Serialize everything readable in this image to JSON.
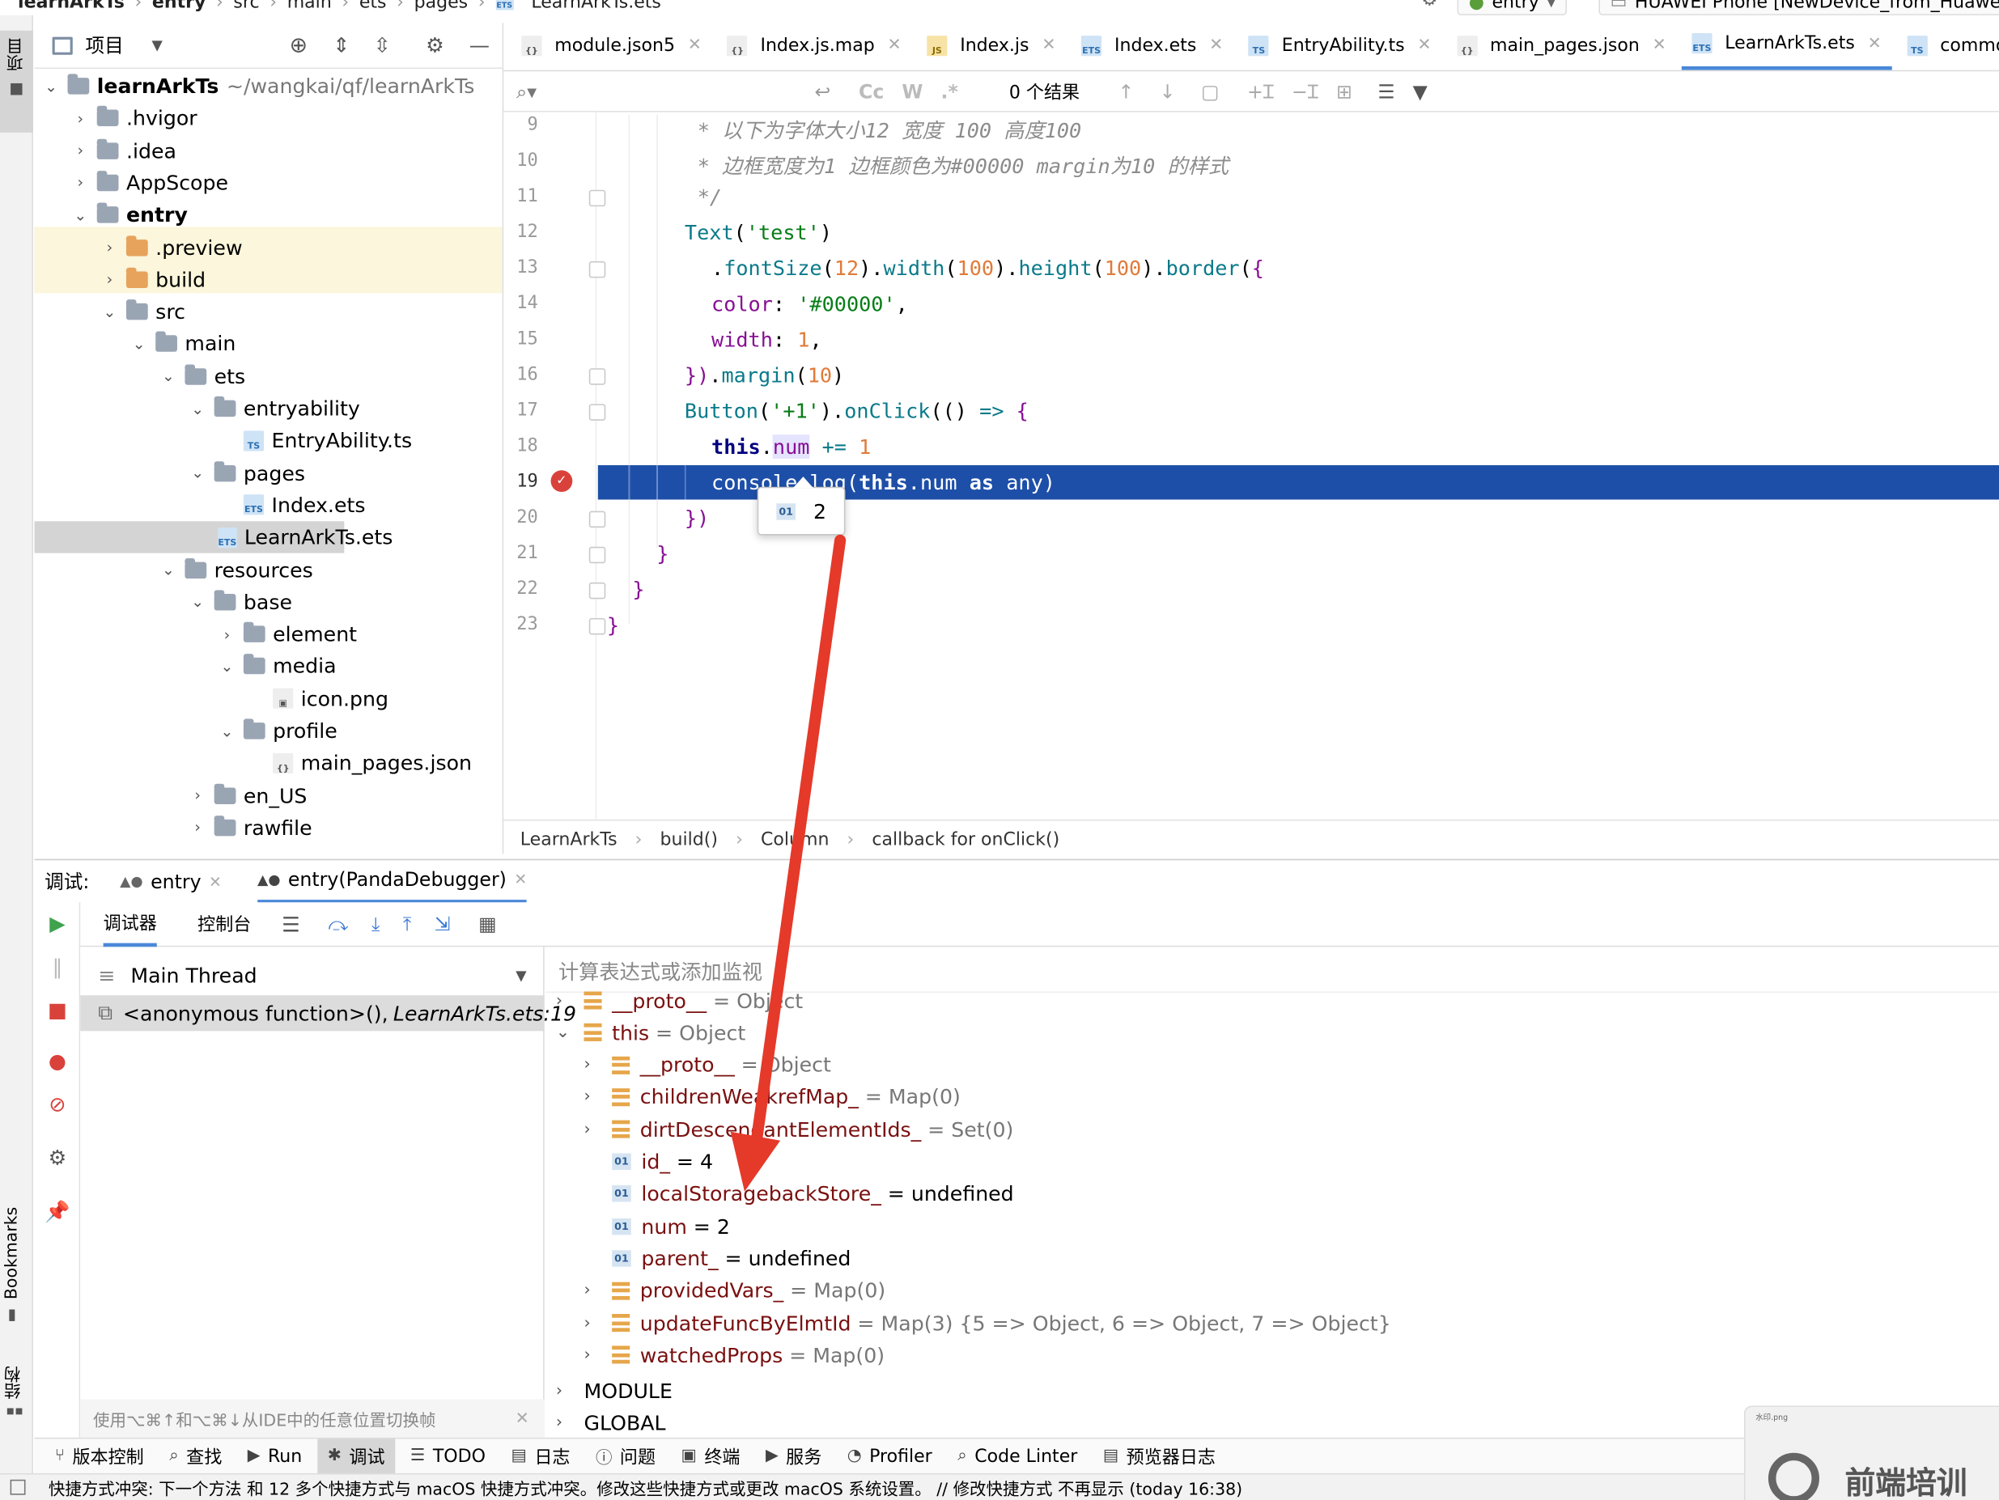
{
  "top_strip": {
    "breadcrumbs": [
      "learnArkTs",
      "entry",
      "src",
      "main",
      "ets",
      "pages",
      "LearnArkTs.ets"
    ],
    "run_config": "entry",
    "device": "HUAWEI Phone [NewDevice_from_Huawei_"
  },
  "left_strip": {
    "project_label": "项目",
    "bookmarks_label": "Bookmarks",
    "structure_label": "结构"
  },
  "project_panel": {
    "title": "项目",
    "root_name": "learnArkTs",
    "root_path": "~/wangkai/qf/learnArkTs",
    "items": [
      {
        "label": ".hvigor",
        "depth": 1,
        "type": "folder",
        "expanded": false
      },
      {
        "label": ".idea",
        "depth": 1,
        "type": "folder",
        "expanded": false
      },
      {
        "label": "AppScope",
        "depth": 1,
        "type": "folder",
        "expanded": false
      },
      {
        "label": "entry",
        "depth": 1,
        "type": "module",
        "expanded": true
      },
      {
        "label": ".preview",
        "depth": 2,
        "type": "folder-orange",
        "expanded": false
      },
      {
        "label": "build",
        "depth": 2,
        "type": "folder-orange",
        "expanded": false
      },
      {
        "label": "src",
        "depth": 2,
        "type": "folder",
        "expanded": true
      },
      {
        "label": "main",
        "depth": 3,
        "type": "folder",
        "expanded": true
      },
      {
        "label": "ets",
        "depth": 4,
        "type": "folder",
        "expanded": true
      },
      {
        "label": "entryability",
        "depth": 5,
        "type": "folder",
        "expanded": true
      },
      {
        "label": "EntryAbility.ts",
        "depth": 6,
        "type": "ts"
      },
      {
        "label": "pages",
        "depth": 5,
        "type": "folder",
        "expanded": true
      },
      {
        "label": "Index.ets",
        "depth": 6,
        "type": "ets"
      },
      {
        "label": "LearnArkTs.ets",
        "depth": 6,
        "type": "ets",
        "selected": true
      },
      {
        "label": "resources",
        "depth": 4,
        "type": "folder",
        "expanded": true
      },
      {
        "label": "base",
        "depth": 5,
        "type": "folder",
        "expanded": true
      },
      {
        "label": "element",
        "depth": 6,
        "type": "folder",
        "expanded": false
      },
      {
        "label": "media",
        "depth": 6,
        "type": "folder",
        "expanded": true
      },
      {
        "label": "icon.png",
        "depth": 7,
        "type": "png"
      },
      {
        "label": "profile",
        "depth": 6,
        "type": "folder",
        "expanded": true
      },
      {
        "label": "main_pages.json",
        "depth": 7,
        "type": "json"
      },
      {
        "label": "en_US",
        "depth": 5,
        "type": "folder",
        "expanded": false
      },
      {
        "label": "rawfile",
        "depth": 5,
        "type": "folder",
        "expanded": false
      }
    ]
  },
  "editor_tabs": [
    {
      "label": "module.json5",
      "icon": "json"
    },
    {
      "label": "Index.js.map",
      "icon": "json"
    },
    {
      "label": "Index.js",
      "icon": "js"
    },
    {
      "label": "Index.ets",
      "icon": "ets"
    },
    {
      "label": "EntryAbility.ts",
      "icon": "ts"
    },
    {
      "label": "main_pages.json",
      "icon": "json"
    },
    {
      "label": "LearnArkTs.ets",
      "icon": "ets",
      "active": true
    },
    {
      "label": "common.d.ts",
      "icon": "ts"
    },
    {
      "label": "TS",
      "icon": "ts"
    }
  ],
  "search_bar": {
    "results": "0 个结果",
    "cc": "Cc",
    "w": "W",
    "regex": ".*"
  },
  "editor": {
    "line_numbers": [
      "9",
      "10",
      "11",
      "12",
      "13",
      "14",
      "15",
      "16",
      "17",
      "18",
      "19",
      "20",
      "21",
      "22",
      "23"
    ],
    "current_line": "19",
    "tooltip_value": "2",
    "breadcrumb": [
      "LearnArkTs",
      "build()",
      "Column",
      "callback for onClick()"
    ]
  },
  "debug_panel": {
    "label": "调试:",
    "sessions": [
      "entry",
      "entry(PandaDebugger)"
    ],
    "tabs": [
      "调试器",
      "控制台"
    ],
    "thread": "Main Thread",
    "frame_name": "<anonymous function>(),",
    "frame_loc": "LearnArkTs.ets:19",
    "hint": "使用⌥⌘↑和⌥⌘↓从IDE中的任意位置切换帧",
    "eval_placeholder": "计算表达式或添加监视"
  },
  "variables": [
    {
      "name": "__proto__",
      "value": "= Object",
      "depth": 1,
      "icon": "map",
      "expandable": true,
      "gray": true
    },
    {
      "name": "this",
      "value": "= Object",
      "depth": 1,
      "icon": "map",
      "expandable": true,
      "expanded": true,
      "gray": true
    },
    {
      "name": "__proto__",
      "value": "= Object",
      "depth": 2,
      "icon": "map",
      "expandable": true,
      "gray": true
    },
    {
      "name": "childrenWeakrefMap_",
      "value": "= Map(0)",
      "depth": 2,
      "icon": "map",
      "expandable": true,
      "gray": true
    },
    {
      "name": "dirtDescendantElementIds_",
      "value": "= Set(0)",
      "depth": 2,
      "icon": "map",
      "expandable": true,
      "gray": true
    },
    {
      "name": "id_",
      "value": "= 4",
      "depth": 2,
      "icon": "o1"
    },
    {
      "name": "localStoragebackStore_",
      "value": "= undefined",
      "depth": 2,
      "icon": "o1"
    },
    {
      "name": "num",
      "value": "= 2",
      "depth": 2,
      "icon": "o1"
    },
    {
      "name": "parent_",
      "value": "= undefined",
      "depth": 2,
      "icon": "o1"
    },
    {
      "name": "providedVars_",
      "value": "= Map(0)",
      "depth": 2,
      "icon": "map",
      "expandable": true,
      "gray": true
    },
    {
      "name": "updateFuncByElmtId",
      "value": "= Map(3) {5 => Object, 6 => Object, 7 => Object}",
      "depth": 2,
      "icon": "map",
      "expandable": true,
      "gray": true
    },
    {
      "name": "watchedProps",
      "value": "= Map(0)",
      "depth": 2,
      "icon": "map",
      "expandable": true,
      "gray": true
    }
  ],
  "sections": [
    "MODULE",
    "GLOBAL"
  ],
  "bottom_tools": [
    {
      "label": "版本控制",
      "icon": "vcs-icon"
    },
    {
      "label": "查找",
      "icon": "search-icon"
    },
    {
      "label": "Run",
      "icon": "run-icon"
    },
    {
      "label": "调试",
      "icon": "debug-icon",
      "active": true
    },
    {
      "label": "TODO",
      "icon": "list-icon"
    },
    {
      "label": "日志",
      "icon": "log-icon"
    },
    {
      "label": "问题",
      "icon": "problem-icon"
    },
    {
      "label": "终端",
      "icon": "terminal-icon"
    },
    {
      "label": "服务",
      "icon": "service-icon"
    },
    {
      "label": "Profiler",
      "icon": "profiler-icon"
    },
    {
      "label": "Code Linter",
      "icon": "linter-icon"
    },
    {
      "label": "预览器日志",
      "icon": "preview-log-icon"
    }
  ],
  "status_bar": {
    "text": "快捷方式冲突: 下一个方法 和 12 多个快捷方式与 macOS 快捷方式冲突。修改这些快捷方式或更改 macOS 系统设置。 // 修改快捷方式   不再显示 (today 16:38)"
  },
  "watermark": {
    "text": "前端培训",
    "file_label": "水印.png"
  },
  "colors": {
    "selection": "#1e4fa8",
    "arrow": "#e5392a",
    "active_tab_underline": "#4a88d8"
  }
}
